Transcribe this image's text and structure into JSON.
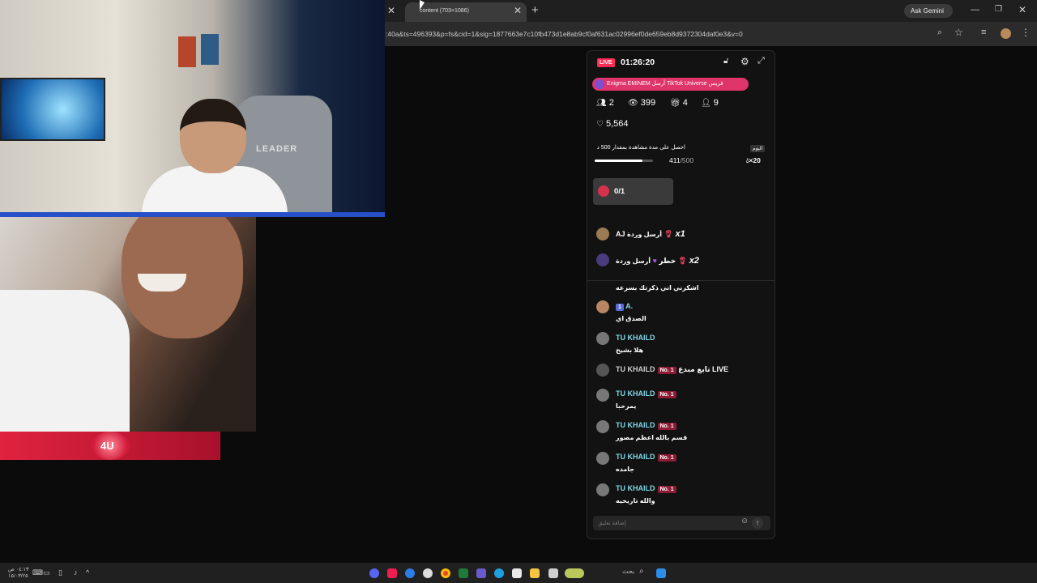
{
  "browser": {
    "tab_title": "content (703×1086)",
    "url": ":40a&ts=496393&p=fs&cid=1&sig=1877663e7c10fb473d1e8ab9cf0af631ac02996ef0de659eb8d9372304daf0e3&v=0",
    "gemini_label": "Ask Gemini",
    "icons": [
      "close-icon",
      "plus-icon",
      "zoom-icon",
      "star-icon",
      "media-icon",
      "menu-icon"
    ]
  },
  "video": {
    "chair_brand": "LEADER",
    "banner_text": "4U"
  },
  "live": {
    "badge": "LIVE",
    "timer": "01:26:20",
    "gift_banner": "Enigma EMINEM أرسل TikTok Universe فريس",
    "stats": {
      "guests": "2",
      "viewers": "399",
      "gifts": "4",
      "followers": "9",
      "likes": "5,564"
    },
    "goal": {
      "text": "احصل على مدة مشاهدة بمقدار 500 د",
      "today": "اليوم",
      "current": "411",
      "total": "/500",
      "progress_fraction": 0.822,
      "reward": "×20"
    },
    "rose_goal": "0/1",
    "gifts": [
      {
        "user": "AJ",
        "action": "أرسل وردة",
        "count": "x1"
      },
      {
        "user": "خطر",
        "action": "أرسل وردة",
        "count": "x2"
      }
    ],
    "messages": [
      {
        "name": "",
        "badge": "",
        "text": "اشكرني اني ذكرتك بسرعه"
      },
      {
        "name": "A.",
        "badge": "1",
        "text": "الصدق اي"
      },
      {
        "name": "TU KHAILD",
        "badge": "",
        "text": "هلا بشيخ"
      },
      {
        "name": "TU KHAILD",
        "badge": "No. 1",
        "text": "تابع مبدع LIVE"
      },
      {
        "name": "TU KHAILD",
        "badge": "No. 1",
        "text": "يمرحبا"
      },
      {
        "name": "TU KHAILD",
        "badge": "No. 1",
        "text": "قسم بالله اعظم مصور"
      },
      {
        "name": "TU KHAILD",
        "badge": "No. 1",
        "text": "جامده"
      },
      {
        "name": "TU KHAILD",
        "badge": "No. 1",
        "text": "والله تاريخيه"
      }
    ],
    "comment_placeholder": "إضافة تعليق"
  },
  "taskbar": {
    "time": "٠٤:١٣ ص",
    "date": "١٥/٠٣/٢٥",
    "search_label": "بحث"
  },
  "colors": {
    "tiktok_red": "#fe2c55",
    "cyan_name": "#7fd8e8",
    "no1_badge": "#8c1c35"
  }
}
